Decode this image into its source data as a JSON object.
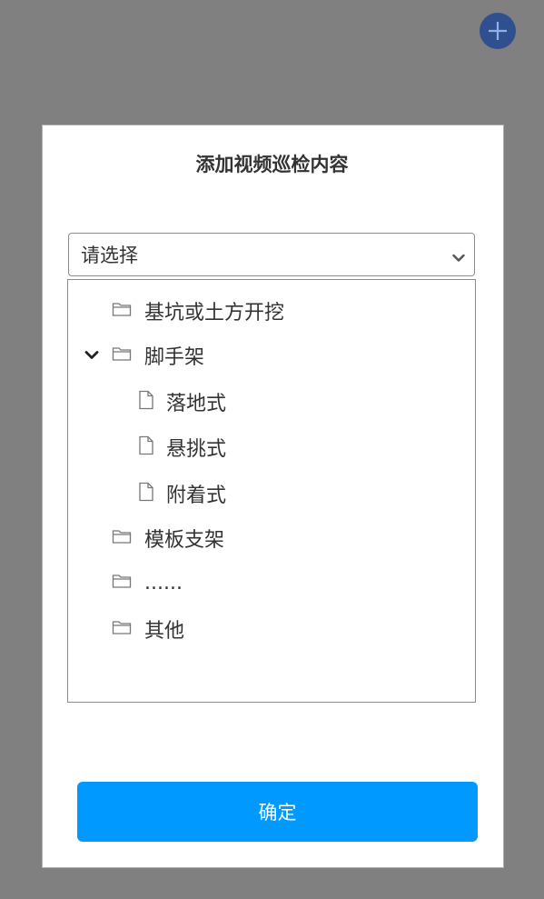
{
  "fab": {
    "icon": "plus-icon"
  },
  "dialog": {
    "title": "添加视频巡检内容",
    "select": {
      "value": "请选择",
      "icon": "chevron-down-icon"
    },
    "tree": {
      "items": [
        {
          "label": "基坑或土方开挖",
          "type": "folder",
          "icon": "folder-icon"
        },
        {
          "label": "脚手架",
          "type": "folder",
          "icon": "folder-icon",
          "expanded": true
        },
        {
          "label": "落地式",
          "type": "file",
          "icon": "file-icon"
        },
        {
          "label": "悬挑式",
          "type": "file",
          "icon": "file-icon"
        },
        {
          "label": "附着式",
          "type": "file",
          "icon": "file-icon"
        },
        {
          "label": "模板支架",
          "type": "folder",
          "icon": "folder-icon"
        },
        {
          "label": "......",
          "type": "folder",
          "icon": "folder-icon"
        },
        {
          "label": "其他",
          "type": "folder",
          "icon": "folder-icon"
        }
      ]
    },
    "confirm_label": "确定"
  },
  "colors": {
    "backdrop": "#808080",
    "fab": "#2f4f8f",
    "primary": "#0099ff",
    "text": "#333333"
  }
}
